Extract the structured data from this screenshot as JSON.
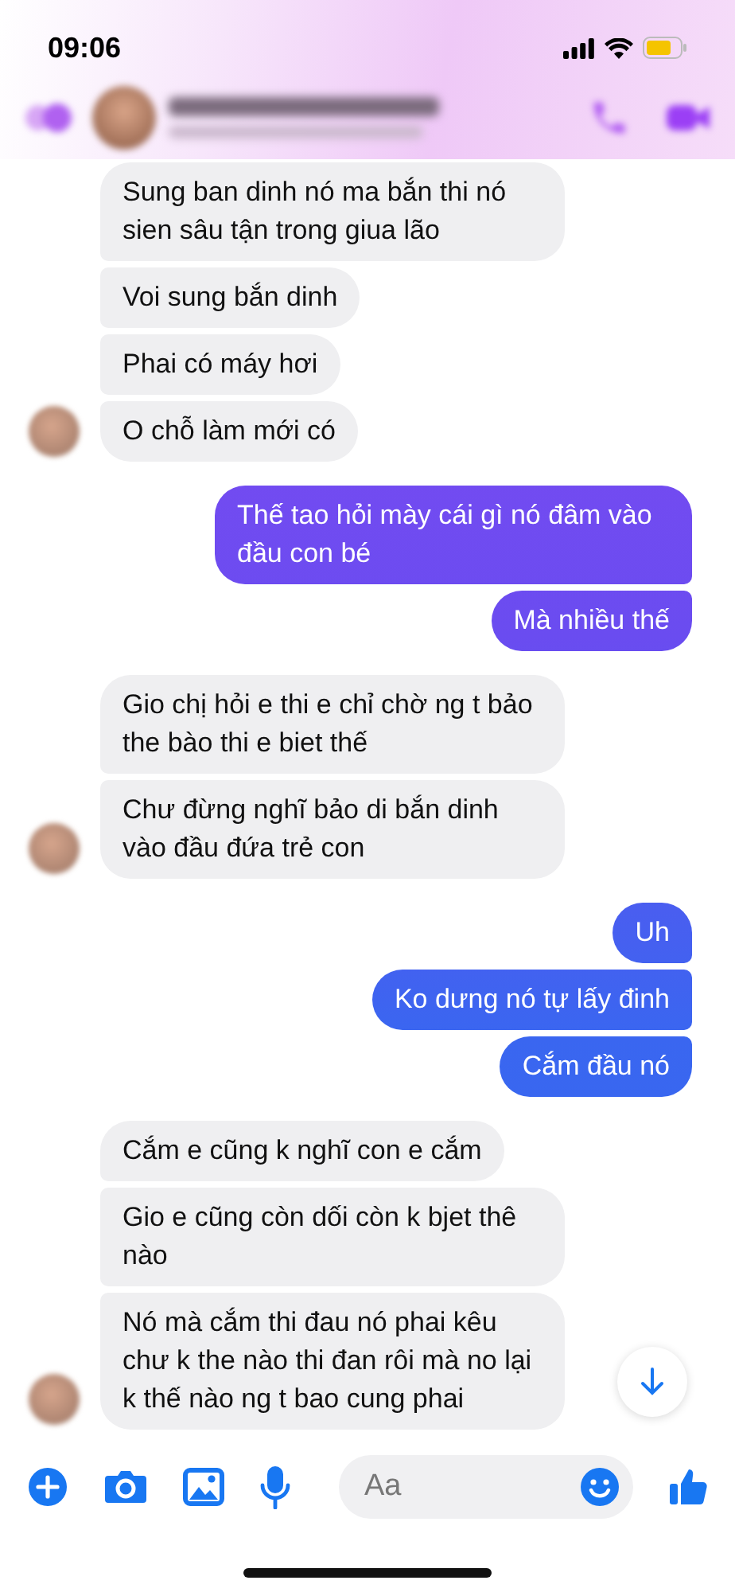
{
  "status_bar": {
    "time": "09:06"
  },
  "groups": [
    {
      "kind": "received",
      "messages": [
        "Sung ban dinh nó ma bắn thi nó sien sâu tận trong giua lão",
        "Voi sung bắn dinh",
        "Phai có máy hơi",
        "O chỗ làm mới có"
      ]
    },
    {
      "kind": "sent",
      "messages": [
        "Thế tao hỏi mày cái gì nó đâm vào đầu con bé",
        "Mà nhiều thế"
      ]
    },
    {
      "kind": "received",
      "messages": [
        "Gio chị hỏi e thi e chỉ chờ ng t bảo the bào thi e biet thế",
        "Chư đừng nghĩ bảo di bắn dinh vào đầu đứa trẻ con"
      ]
    },
    {
      "kind": "sent",
      "messages": [
        "Uh",
        "Ko dưng nó tự lấy đinh",
        "Cắm đầu nó"
      ]
    },
    {
      "kind": "received",
      "messages": [
        "Cắm e cũng k nghĩ con e cắm",
        "Gio e cũng còn dối còn k bjet thê nào",
        "Nó mà cắm thi đau nó phai kêu chư k the nào thi đan rôi mà no lại k thế nào ng t bao cung phai"
      ]
    }
  ],
  "composer": {
    "placeholder": "Aa"
  }
}
